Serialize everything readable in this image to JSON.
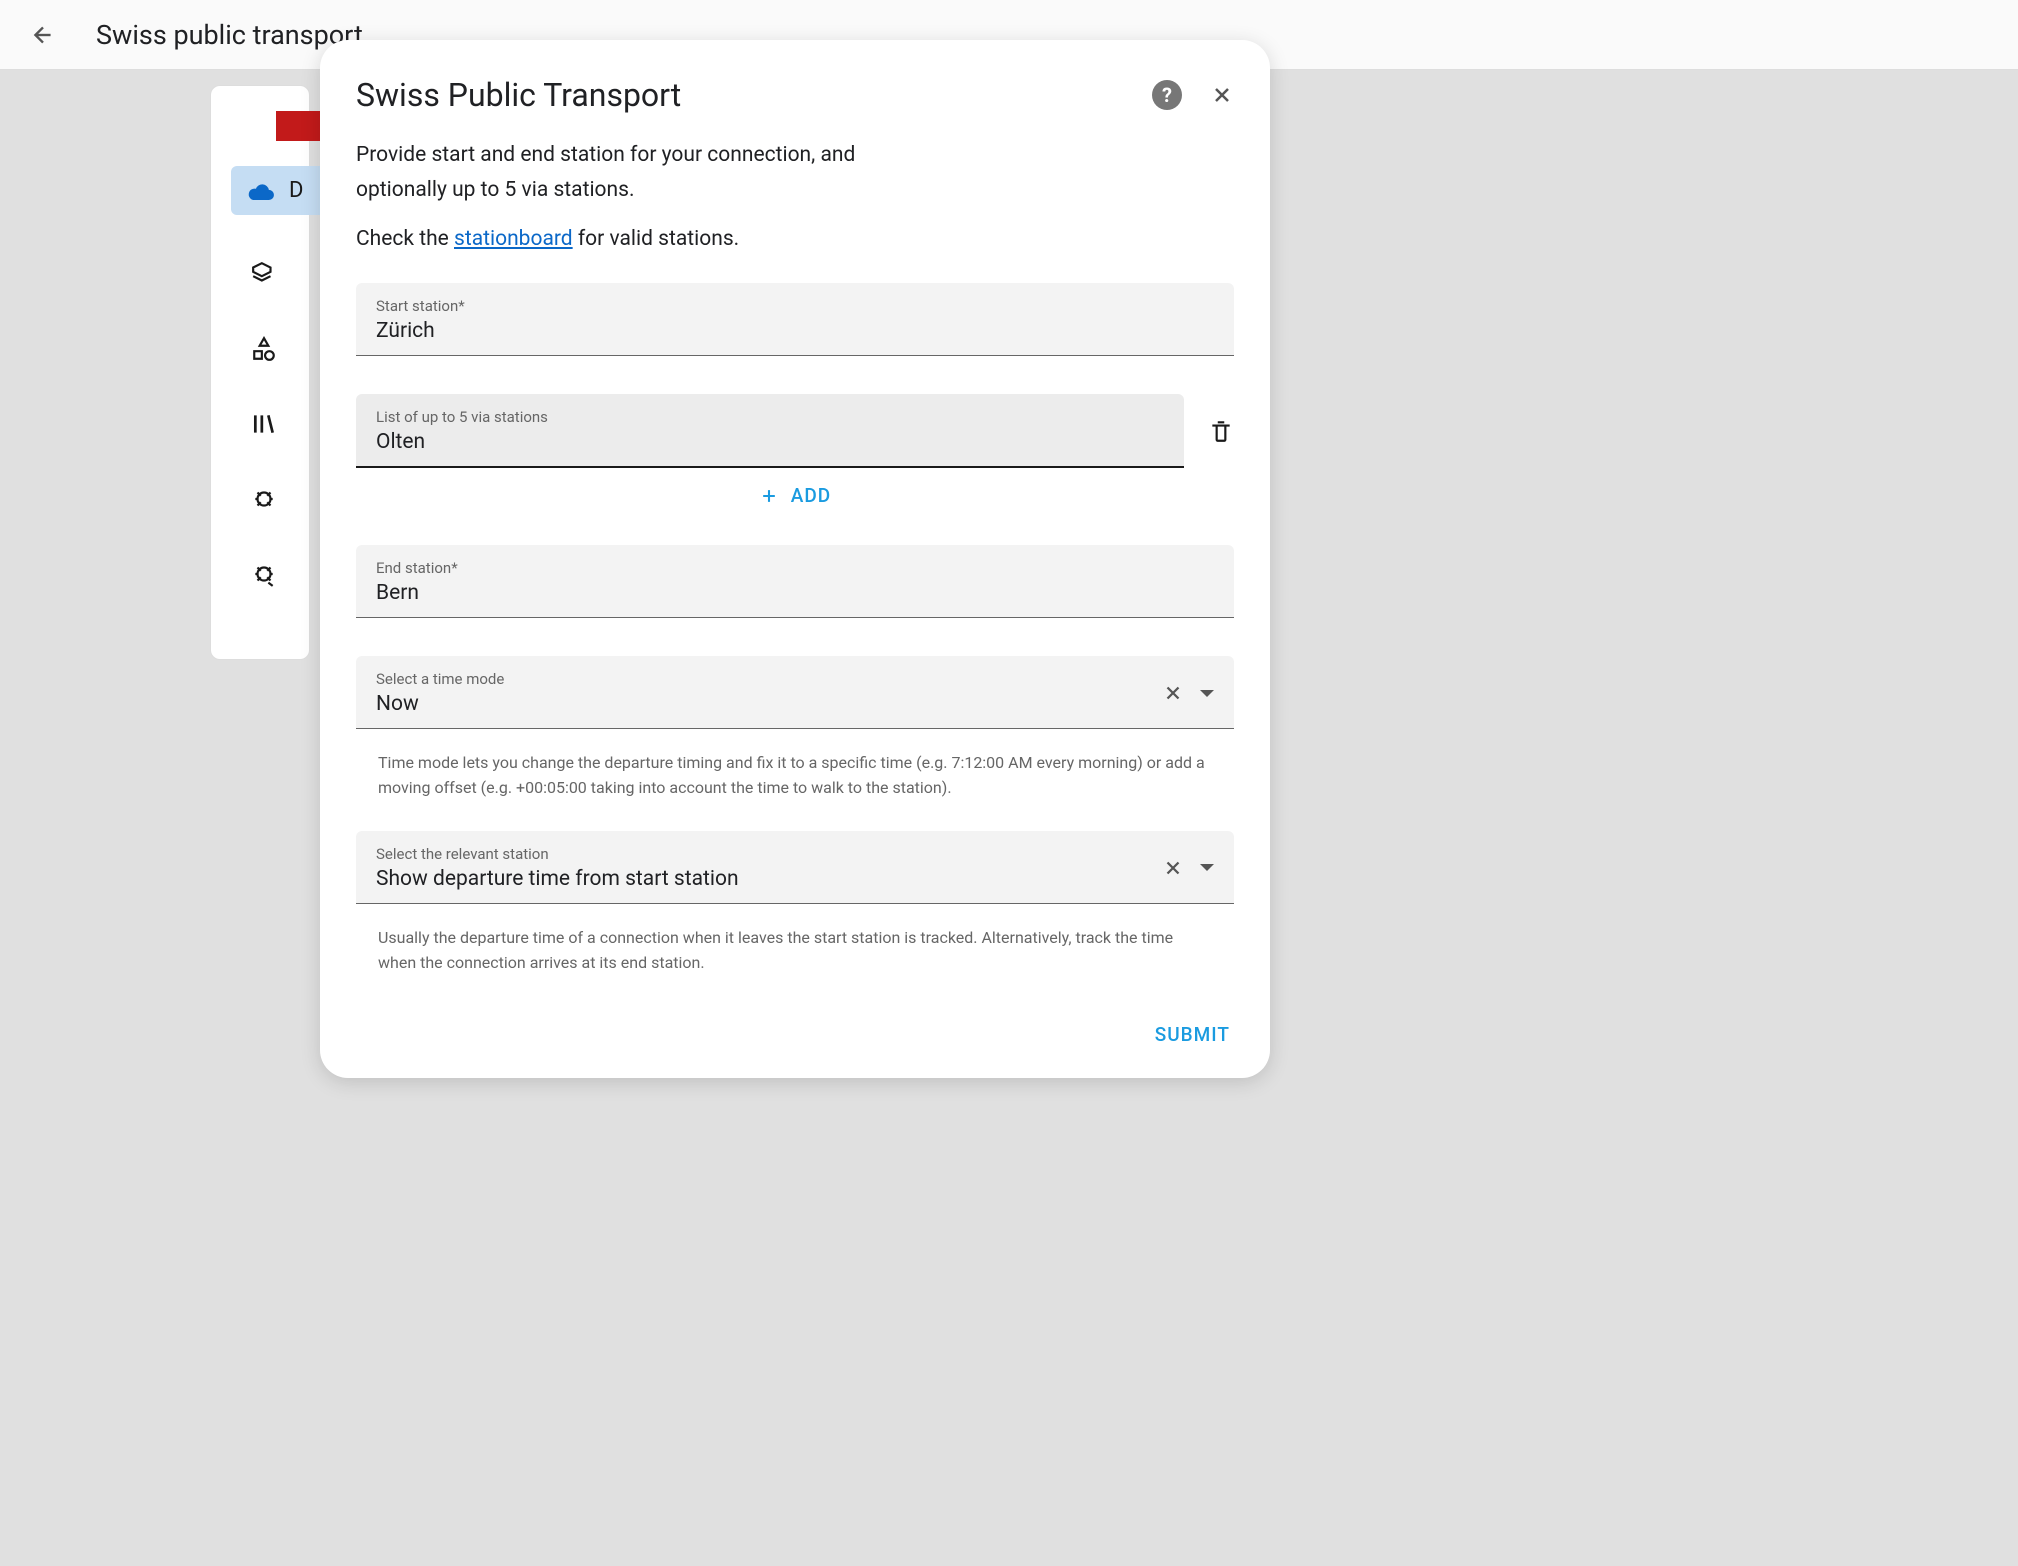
{
  "page": {
    "title": "Swiss public transport"
  },
  "sidebar": {
    "letter": "D"
  },
  "dialog": {
    "title": "Swiss Public Transport",
    "intro": "Provide start and end station for your connection, and optionally up to 5 via stations.",
    "check_prefix": "Check the ",
    "check_link": "stationboard",
    "check_suffix": " for valid stations.",
    "start_label": "Start station*",
    "start_value": "Zürich",
    "via_label": "List of up to 5 via stations",
    "via_value": "Olten",
    "add_label": "ADD",
    "end_label": "End station*",
    "end_value": "Bern",
    "time_mode_label": "Select a time mode",
    "time_mode_value": "Now",
    "time_mode_helper": "Time mode lets you change the departure timing and fix it to a specific time (e.g. 7:12:00 AM every morning) or add a moving offset (e.g. +00:05:00 taking into account the time to walk to the station).",
    "relevant_station_label": "Select the relevant station",
    "relevant_station_value": "Show departure time from start station",
    "relevant_station_helper": "Usually the departure time of a connection when it leaves the start station is tracked. Alternatively, track the time when the connection arrives at its end station.",
    "submit": "SUBMIT"
  }
}
